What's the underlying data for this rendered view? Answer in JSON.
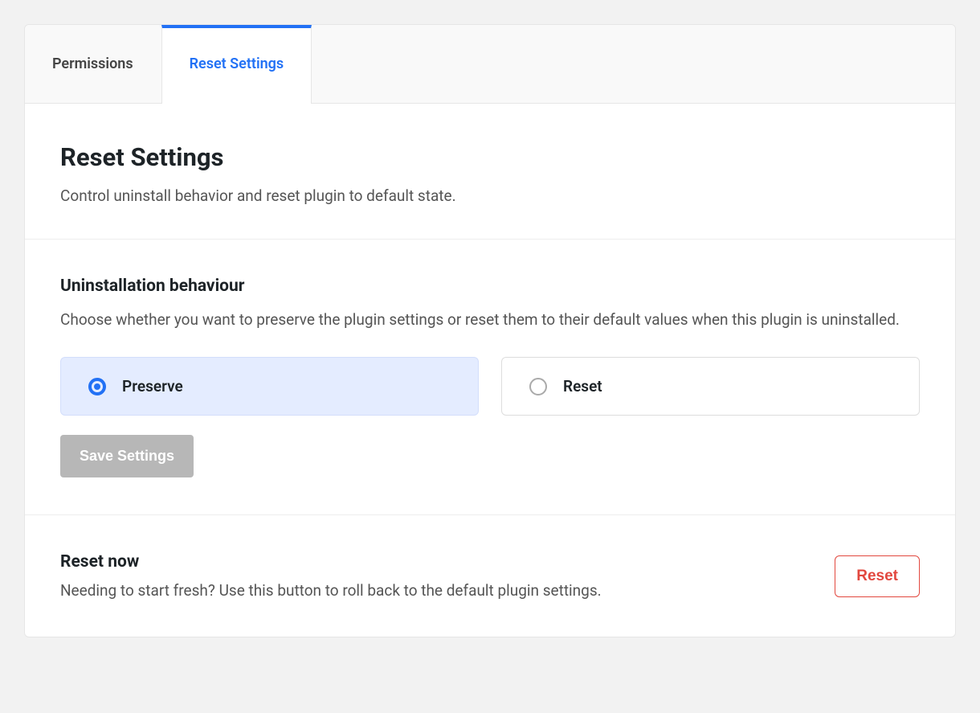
{
  "tabs": {
    "permissions": "Permissions",
    "reset_settings": "Reset Settings"
  },
  "header": {
    "title": "Reset Settings",
    "subtitle": "Control uninstall behavior and reset plugin to default state."
  },
  "uninstall": {
    "heading": "Uninstallation behaviour",
    "description": "Choose whether you want to preserve the plugin settings or reset them to their default values when this plugin is uninstalled.",
    "options": {
      "preserve": "Preserve",
      "reset": "Reset"
    },
    "save_button": "Save Settings"
  },
  "reset_now": {
    "heading": "Reset now",
    "description": "Needing to start fresh? Use this button to roll back to the default plugin settings.",
    "button": "Reset"
  }
}
